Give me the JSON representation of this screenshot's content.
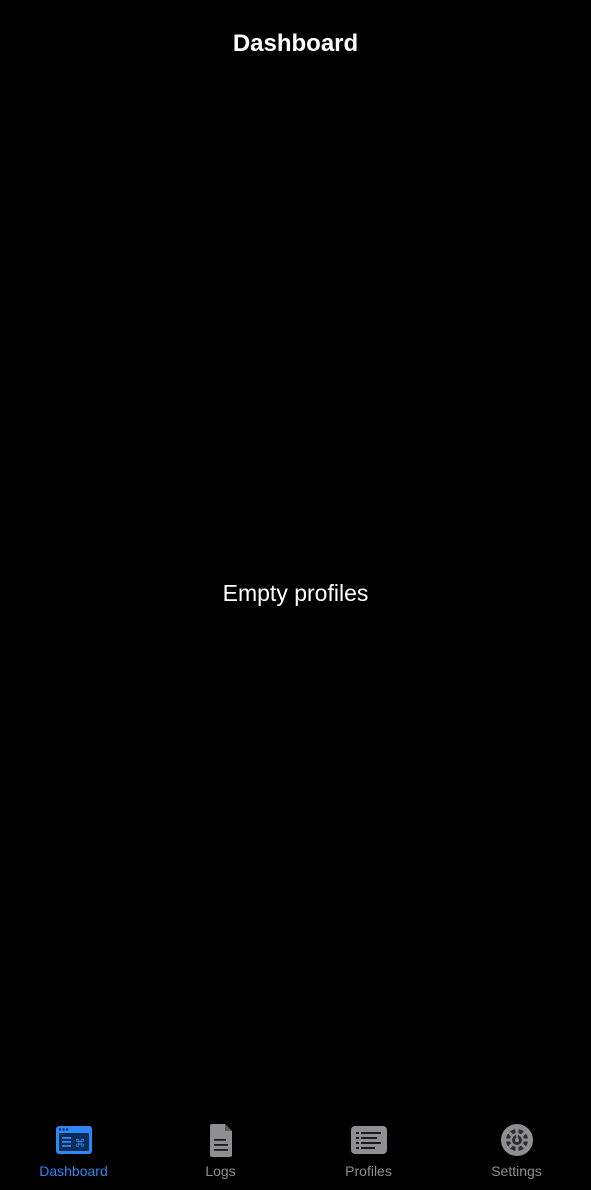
{
  "header": {
    "title": "Dashboard"
  },
  "main": {
    "empty_message": "Empty profiles"
  },
  "tab_bar": {
    "active_color": "#2f86f6",
    "inactive_color": "#8e8e93",
    "tabs": [
      {
        "label": "Dashboard",
        "icon": "terminal-window-icon",
        "active": true
      },
      {
        "label": "Logs",
        "icon": "document-icon",
        "active": false
      },
      {
        "label": "Profiles",
        "icon": "list-icon",
        "active": false
      },
      {
        "label": "Settings",
        "icon": "gear-icon",
        "active": false
      }
    ]
  }
}
